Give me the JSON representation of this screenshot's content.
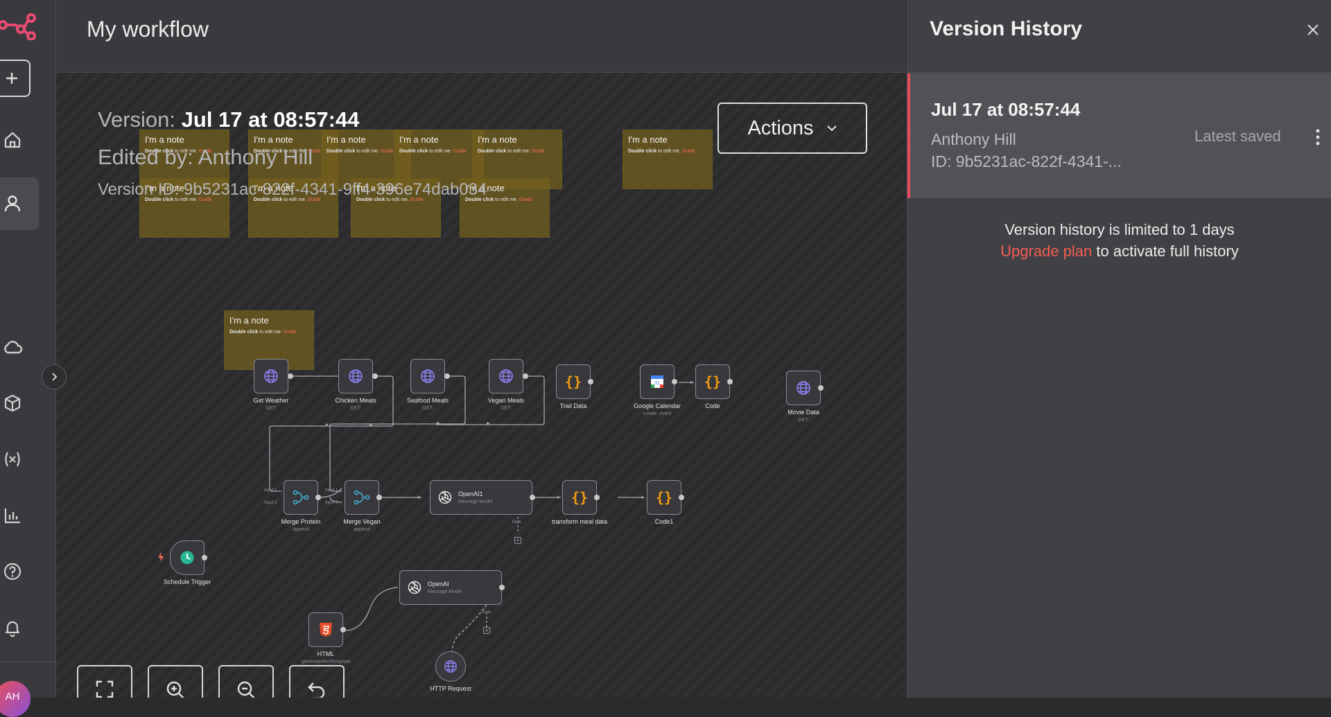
{
  "workflow": {
    "title": "My workflow"
  },
  "version_info": {
    "version_label": "Version:",
    "version_value": "Jul 17 at 08:57:44",
    "edited_by": "Edited by: Anthony Hill",
    "version_id": "Version ID: 9b5231ac-822f-4341-9ff4-396e74dab034"
  },
  "actions": {
    "label": "Actions"
  },
  "note": {
    "title": "I'm a note",
    "body_bold": "Double click",
    "body_text": " to edit me. ",
    "body_link": "Guide"
  },
  "nodes": {
    "get_weather": {
      "label": "Get Weather",
      "sub": "GET:"
    },
    "chicken_meals": {
      "label": "Chicken Meals",
      "sub": "GET:"
    },
    "seafood_meals": {
      "label": "Seafood Meals",
      "sub": "GET:"
    },
    "vegan_meals": {
      "label": "Vegan Meals",
      "sub": "GET:"
    },
    "trail_data": {
      "label": "Trail Data"
    },
    "google_calendar": {
      "label": "Google Calendar",
      "sub": "create: event"
    },
    "code": {
      "label": "Code"
    },
    "movie_data": {
      "label": "Movie Data",
      "sub": "GET:"
    },
    "merge_protein": {
      "label": "Merge Protein",
      "sub": "append"
    },
    "merge_vegan": {
      "label": "Merge Vegan",
      "sub": "append"
    },
    "openai1": {
      "label": "OpenAI1",
      "sub": "Message Model"
    },
    "transform": {
      "label": "transform meal data"
    },
    "code1": {
      "label": "Code1"
    },
    "schedule": {
      "label": "Schedule Trigger"
    },
    "openai": {
      "label": "OpenAI",
      "sub": "Message Model"
    },
    "html": {
      "label": "HTML",
      "sub": "generateHtmlTemplate"
    },
    "http": {
      "label": "HTTP Request"
    }
  },
  "ports": {
    "input1": "Input 1",
    "input2": "Input 2",
    "tools": "Tools"
  },
  "panel": {
    "title": "Version History",
    "entry": {
      "date": "Jul 17 at 08:57:44",
      "user": "Anthony Hill",
      "id": "ID: 9b5231ac-822f-4341-...",
      "status": "Latest saved"
    },
    "limit_text": "Version history is limited to 1 days",
    "upgrade_link": "Upgrade plan",
    "limit_suffix": " to activate full history"
  },
  "user": {
    "initials": "AH"
  },
  "colors": {
    "brand": "#ea4b71",
    "accent": "#ea4b5c",
    "link": "#ff6d5a",
    "code": "#f39c12",
    "trigger": "#29b694",
    "merge": "#42a5c7"
  },
  "icons": [
    "n8n-logo-icon",
    "plus-icon",
    "home-icon",
    "user-icon",
    "cloud-icon",
    "cube-icon",
    "variables-icon",
    "chart-icon",
    "help-icon",
    "bell-icon",
    "chevron-right-icon",
    "chevron-down-icon",
    "close-icon",
    "more-vertical-icon",
    "globe-icon",
    "code-icon",
    "merge-icon",
    "openai-icon",
    "clock-icon",
    "html5-icon",
    "calendar-icon",
    "fit-view-icon",
    "zoom-in-icon",
    "zoom-out-icon",
    "undo-icon"
  ]
}
